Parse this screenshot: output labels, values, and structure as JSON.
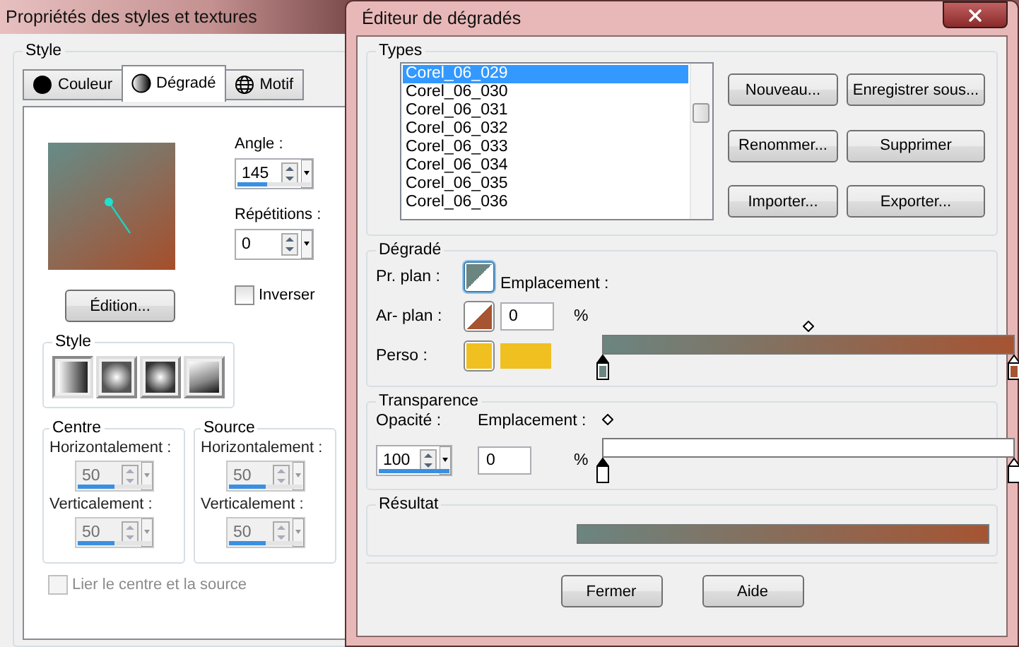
{
  "left_window": {
    "title": "Propriétés des styles et textures",
    "group_title": "Style",
    "tabs": [
      {
        "label": "Couleur",
        "kind": "color",
        "selected": false
      },
      {
        "label": "Dégradé",
        "kind": "gradient",
        "selected": true
      },
      {
        "label": "Motif",
        "kind": "pattern",
        "selected": false
      }
    ],
    "angle": {
      "label": "Angle :",
      "value": "145",
      "level": 0.4
    },
    "repetitions": {
      "label": "Répétitions :",
      "value": "0"
    },
    "edit_button": "Édition...",
    "invert": {
      "label": "Inverser",
      "checked": false
    },
    "style_group": {
      "title": "Style",
      "options": [
        {
          "kind": "linear",
          "selected": true
        },
        {
          "kind": "rectangular",
          "selected": false
        },
        {
          "kind": "radial",
          "selected": false
        },
        {
          "kind": "corner",
          "selected": false
        }
      ]
    },
    "centre": {
      "title": "Centre",
      "fields": [
        {
          "label": "Horizontalement :",
          "value": "50",
          "level": 0.5,
          "disabled": true
        },
        {
          "label": "Verticalement :",
          "value": "50",
          "level": 0.5,
          "disabled": true
        }
      ]
    },
    "source": {
      "title": "Source",
      "fields": [
        {
          "label": "Horizontalement :",
          "value": "50",
          "level": 0.5,
          "disabled": true
        },
        {
          "label": "Verticalement :",
          "value": "50",
          "level": 0.5,
          "disabled": true
        }
      ]
    },
    "link": {
      "label": "Lier le centre et la source",
      "checked": false,
      "disabled": true
    }
  },
  "editor": {
    "title": "Éditeur de dégradés",
    "types": {
      "title": "Types",
      "items": [
        {
          "label": "Corel_06_029",
          "selected": true
        },
        {
          "label": "Corel_06_030",
          "selected": false
        },
        {
          "label": "Corel_06_031",
          "selected": false
        },
        {
          "label": "Corel_06_032",
          "selected": false
        },
        {
          "label": "Corel_06_033",
          "selected": false
        },
        {
          "label": "Corel_06_034",
          "selected": false
        },
        {
          "label": "Corel_06_035",
          "selected": false
        },
        {
          "label": "Corel_06_036",
          "selected": false
        }
      ],
      "buttons": [
        "Nouveau...",
        "Enregistrer sous...",
        "Renommer...",
        "Supprimer",
        "Importer...",
        "Exporter..."
      ]
    },
    "gradient": {
      "title": "Dégradé",
      "location_label": "Emplacement :",
      "location_value": "0",
      "unit": "%",
      "stops": [
        {
          "kind": "foreground",
          "label": "Pr. plan :",
          "color": "#6b8580",
          "selected": true
        },
        {
          "kind": "background",
          "label": "Ar- plan :",
          "color": "#a65432",
          "selected": false
        }
      ],
      "custom": {
        "label": "Perso :",
        "color": "#f0c020"
      }
    },
    "transparency": {
      "title": "Transparence",
      "opacity_label": "Opacité :",
      "opacity_value": "100",
      "level": 1,
      "location_label": "Emplacement :",
      "location_value": "0",
      "unit": "%"
    },
    "result": {
      "title": "Résultat"
    },
    "footer_buttons": [
      "Fermer",
      "Aide"
    ]
  }
}
